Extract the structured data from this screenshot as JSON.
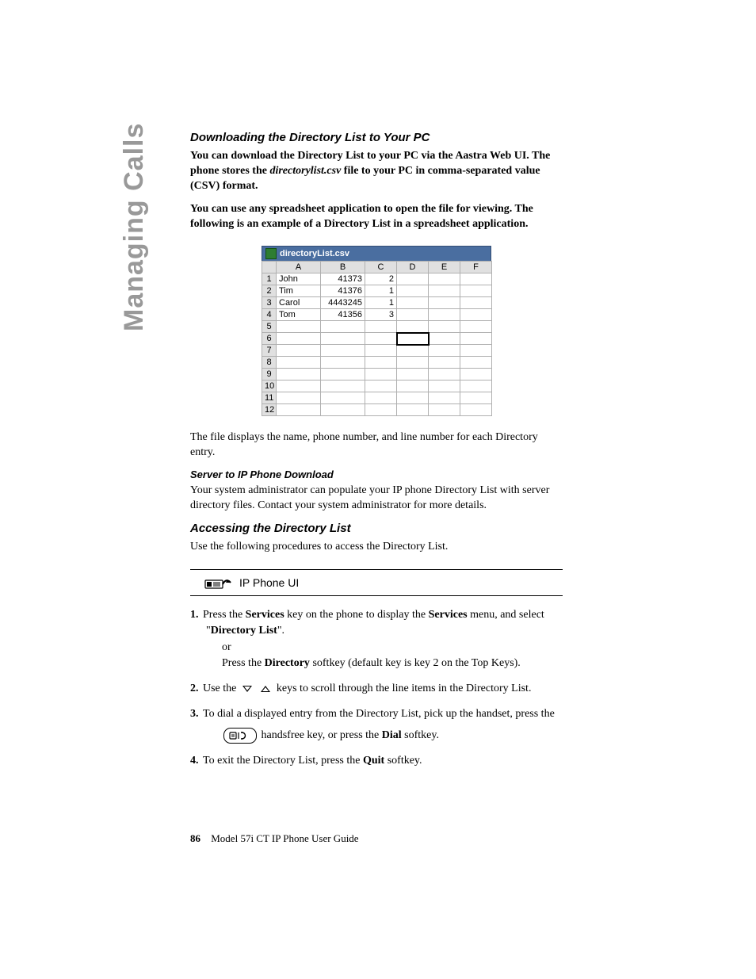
{
  "sidebar": {
    "title": "Managing Calls"
  },
  "s1": {
    "heading": "Downloading the Directory List to Your PC",
    "p1a": "You can download the Directory List to your PC via the Aastra Web UI. The phone stores the ",
    "p1b": "directorylist.csv",
    "p1c": " file to your PC in comma-separated value (CSV) format.",
    "p2": "You can use any spreadsheet application to open the file for viewing. The following is an example of a Directory List in a spreadsheet application."
  },
  "sheet": {
    "filename": "directoryList.csv",
    "cols": [
      "A",
      "B",
      "C",
      "D",
      "E",
      "F"
    ],
    "rowCount": 12,
    "rows": [
      {
        "A": "John",
        "B": "41373",
        "C": "2"
      },
      {
        "A": "Tim",
        "B": "41376",
        "C": "1"
      },
      {
        "A": "Carol",
        "B": "4443245",
        "C": "1"
      },
      {
        "A": "Tom",
        "B": "41356",
        "C": "3"
      }
    ],
    "activeCell": {
      "row": 6,
      "col": "D"
    }
  },
  "s2": {
    "p1": "The file displays the name, phone number, and line number for each Directory entry.",
    "subheading": "Server to IP Phone Download",
    "p2": "Your system administrator can populate your IP phone Directory List with server directory files. Contact your system administrator for more details."
  },
  "s3": {
    "heading": "Accessing the Directory List",
    "p1": "Use the following procedures to access the Directory List."
  },
  "uiBar": {
    "label": "IP Phone UI"
  },
  "steps": {
    "s1_a": "Press the ",
    "s1_b": "Services",
    "s1_c": " key on the phone to display the ",
    "s1_d": "Services",
    "s1_e": " menu, and select \"",
    "s1_f": "Directory List",
    "s1_g": "\".",
    "s1_or": "or",
    "s1_h": "Press the ",
    "s1_i": "Directory",
    "s1_j": " softkey (default key is key 2 on the Top Keys).",
    "s2_a": "Use the ",
    "s2_b": " keys to scroll through the line items in the Directory List.",
    "s3_a": "To dial a displayed entry from the Directory List, pick up the handset, press the ",
    "s3_b": " handsfree key, or press the ",
    "s3_c": "Dial",
    "s3_d": " softkey.",
    "s4_a": "To exit the Directory List, press the ",
    "s4_b": "Quit",
    "s4_c": " softkey."
  },
  "footer": {
    "page": "86",
    "title": "Model 57i CT IP Phone User Guide"
  }
}
